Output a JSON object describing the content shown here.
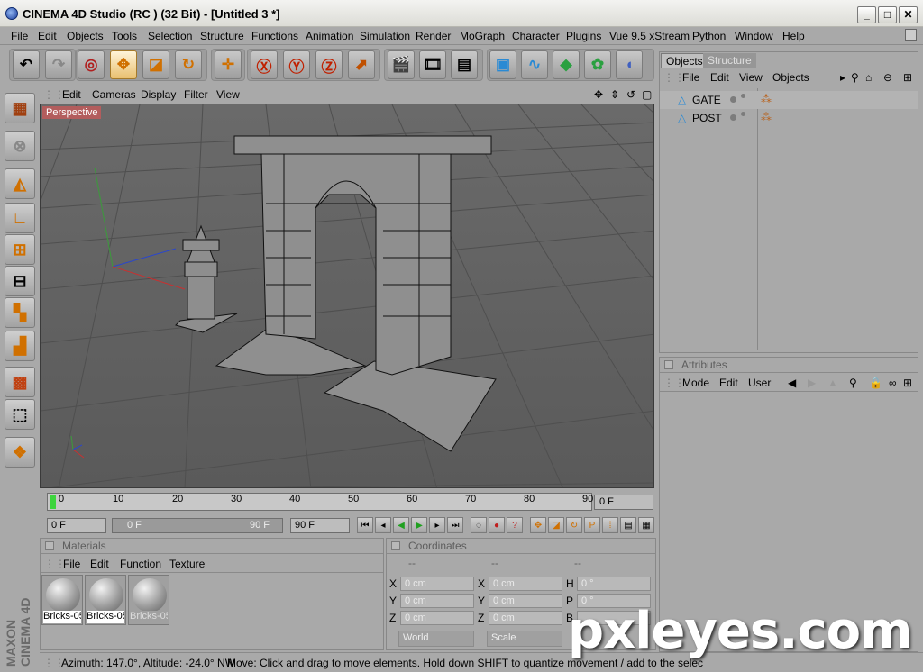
{
  "window": {
    "title": "CINEMA 4D Studio (RC ) (32 Bit) - [Untitled 3 *]"
  },
  "menubar": [
    "File",
    "Edit",
    "Objects",
    "Tools",
    "Selection",
    "Structure",
    "Functions",
    "Animation",
    "Simulation",
    "Render",
    "MoGraph",
    "Character",
    "Plugins",
    "Vue 9.5 xStream",
    "Python",
    "Window",
    "Help"
  ],
  "viewport": {
    "menu": [
      "Edit",
      "Cameras",
      "Display",
      "Filter",
      "View"
    ],
    "label": "Perspective"
  },
  "timeline": {
    "ticks": [
      "0",
      "10",
      "20",
      "30",
      "40",
      "50",
      "60",
      "70",
      "80",
      "90"
    ],
    "current": "0 F",
    "start": "0 F",
    "range_start": "0 F",
    "range_end": "90 F",
    "end": "90 F"
  },
  "materials": {
    "header": "Materials",
    "menu": [
      "File",
      "Edit",
      "Function",
      "Texture"
    ],
    "items": [
      "Bricks-05",
      "Bricks-05",
      "Bricks-05"
    ]
  },
  "coordinates": {
    "header": "Coordinates",
    "col_headers": [
      "--",
      "--",
      "--"
    ],
    "rows": [
      {
        "l1": "X",
        "v1": "0 cm",
        "l2": "X",
        "v2": "0 cm",
        "l3": "H",
        "v3": "0 °"
      },
      {
        "l1": "Y",
        "v1": "0 cm",
        "l2": "Y",
        "v2": "0 cm",
        "l3": "P",
        "v3": "0 °"
      },
      {
        "l1": "Z",
        "v1": "0 cm",
        "l2": "Z",
        "v2": "0 cm",
        "l3": "B",
        "v3": ""
      }
    ],
    "mode1": "World",
    "mode2": "Scale"
  },
  "objects_panel": {
    "tabs": [
      "Objects",
      "Structure"
    ],
    "menu": [
      "File",
      "Edit",
      "View",
      "Objects"
    ],
    "items": [
      "GATE",
      "POST"
    ]
  },
  "attributes_panel": {
    "header": "Attributes",
    "menu": [
      "Mode",
      "Edit",
      "User"
    ]
  },
  "status": {
    "orientation": "Azimuth: 147.0°, Altitude: -24.0°  NW",
    "message": "Move: Click and drag to move elements. Hold down SHIFT to quantize movement / add to the selec"
  },
  "branding": {
    "side": "MAXON CINEMA 4D",
    "watermark": "pxleyes.com"
  },
  "colors": {
    "accent_tab": "#b35d5d",
    "grid": "#555555"
  }
}
